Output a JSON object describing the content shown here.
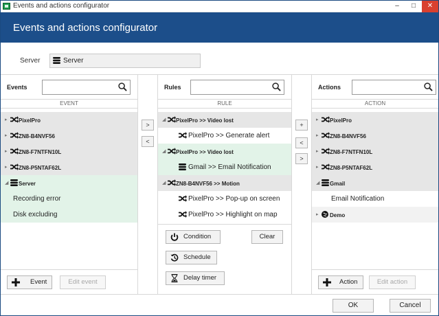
{
  "window": {
    "title": "Events and actions configurator",
    "min_glyph": "–",
    "max_glyph": "□",
    "close_glyph": "✕"
  },
  "header": {
    "title": "Events and actions configurator"
  },
  "server": {
    "label": "Server",
    "value": "Server"
  },
  "events": {
    "label": "Events",
    "search_value": "",
    "column": "EVENT",
    "items": [
      {
        "text": "PixelPro",
        "kind": "group",
        "icon": "shuffle-icon"
      },
      {
        "text": "ZN8-B4NVF56",
        "kind": "group",
        "icon": "shuffle-icon"
      },
      {
        "text": "ZN8-F7NTFN10L",
        "kind": "group",
        "icon": "shuffle-icon"
      },
      {
        "text": "ZN8-P5NTAF62L",
        "kind": "group",
        "icon": "shuffle-icon"
      },
      {
        "text": "Server",
        "kind": "group-open",
        "icon": "server-icon"
      },
      {
        "text": "Recording error",
        "kind": "leaf"
      },
      {
        "text": "Disk excluding",
        "kind": "leaf"
      }
    ],
    "add_label": "Event",
    "edit_label": "Edit event"
  },
  "transfer_left": {
    "add": ">",
    "remove": "<"
  },
  "rules": {
    "label": "Rules",
    "search_value": "",
    "column": "RULE",
    "items": [
      {
        "text": "PixelPro >> Video lost",
        "kind": "group"
      },
      {
        "text": "PixelPro >> Generate alert",
        "kind": "leaf"
      },
      {
        "text": "PixelPro >> Video lost",
        "kind": "group"
      },
      {
        "text": "Gmail >> Email Notification",
        "kind": "leaf"
      },
      {
        "text": "ZN8-B4NVF56 >> Motion",
        "kind": "group"
      },
      {
        "text": "PixelPro >> Pop-up on screen",
        "kind": "leaf"
      },
      {
        "text": "PixelPro >>  Highlight on map",
        "kind": "leaf"
      }
    ],
    "condition_label": "Condition",
    "clear_label": "Clear",
    "schedule_label": "Schedule",
    "delay_label": "Delay timer"
  },
  "transfer_right": {
    "plus": "+",
    "remove": "<",
    "add": ">"
  },
  "actions": {
    "label": "Actions",
    "search_value": "",
    "column": "ACTION",
    "items": [
      {
        "text": "PixelPro",
        "kind": "group"
      },
      {
        "text": "ZN8-B4NVF56",
        "kind": "group"
      },
      {
        "text": "ZN8-F7NTFN10L",
        "kind": "group"
      },
      {
        "text": "ZN8-P5NTAF62L",
        "kind": "group"
      },
      {
        "text": "Gmail",
        "kind": "group-open"
      },
      {
        "text": "Email Notification",
        "kind": "leaf"
      },
      {
        "text": "Demo",
        "kind": "group"
      }
    ],
    "add_label": "Action",
    "edit_label": "Edit action"
  },
  "footer": {
    "ok": "OK",
    "cancel": "Cancel"
  },
  "colors": {
    "header": "#1c4e8a",
    "close": "#d9402f",
    "selected": "#e2f3e8",
    "group": "#e6e6e6"
  },
  "arrows": {
    "closed": "▸",
    "open": "◢"
  }
}
